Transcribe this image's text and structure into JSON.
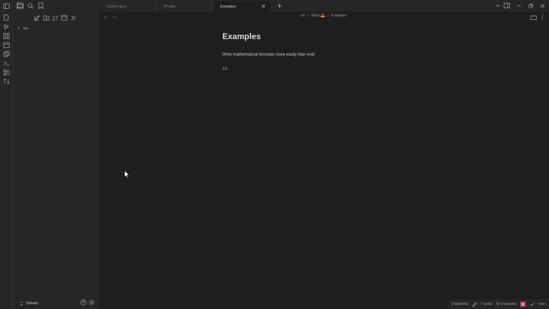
{
  "tabs": [
    {
      "label": "OctoPy docs",
      "active": false
    },
    {
      "label": "TP Algo",
      "active": false
    },
    {
      "label": "Examples",
      "active": true
    }
  ],
  "breadcrumb": {
    "parts": [
      "src",
      "Inbox 📥",
      "Examples"
    ],
    "separator": "/"
  },
  "file_tree": {
    "items": [
      {
        "label": "src",
        "type": "folder",
        "expanded": false
      }
    ]
  },
  "vault": {
    "name": "School"
  },
  "note": {
    "title": "Examples",
    "line": "Write mathematical formulas more easily than ever",
    "math": "$$"
  },
  "status_bar": {
    "backlinks": "0 backlinks",
    "words": "7 words",
    "characters": "56 characters",
    "branch": "main"
  },
  "colors": {
    "background": "#1e1e1e",
    "sidebar": "#262626",
    "accent_math": "#8a7fd4",
    "status_badge": "#c0334d"
  },
  "icons": {
    "ribbon": [
      "file-icon",
      "git-branch-icon",
      "graph-icon",
      "calendar-icon",
      "copy-icon",
      "terminal-icon",
      "blocks-icon",
      "sort-icon"
    ],
    "sidebar_tabs": [
      "sidebar-toggle-icon",
      "folder-icon",
      "search-icon",
      "bookmark-icon"
    ],
    "nav_actions": [
      "new-note-icon",
      "new-folder-icon",
      "sort-icon",
      "collapse-all-icon",
      "close-icon"
    ]
  }
}
